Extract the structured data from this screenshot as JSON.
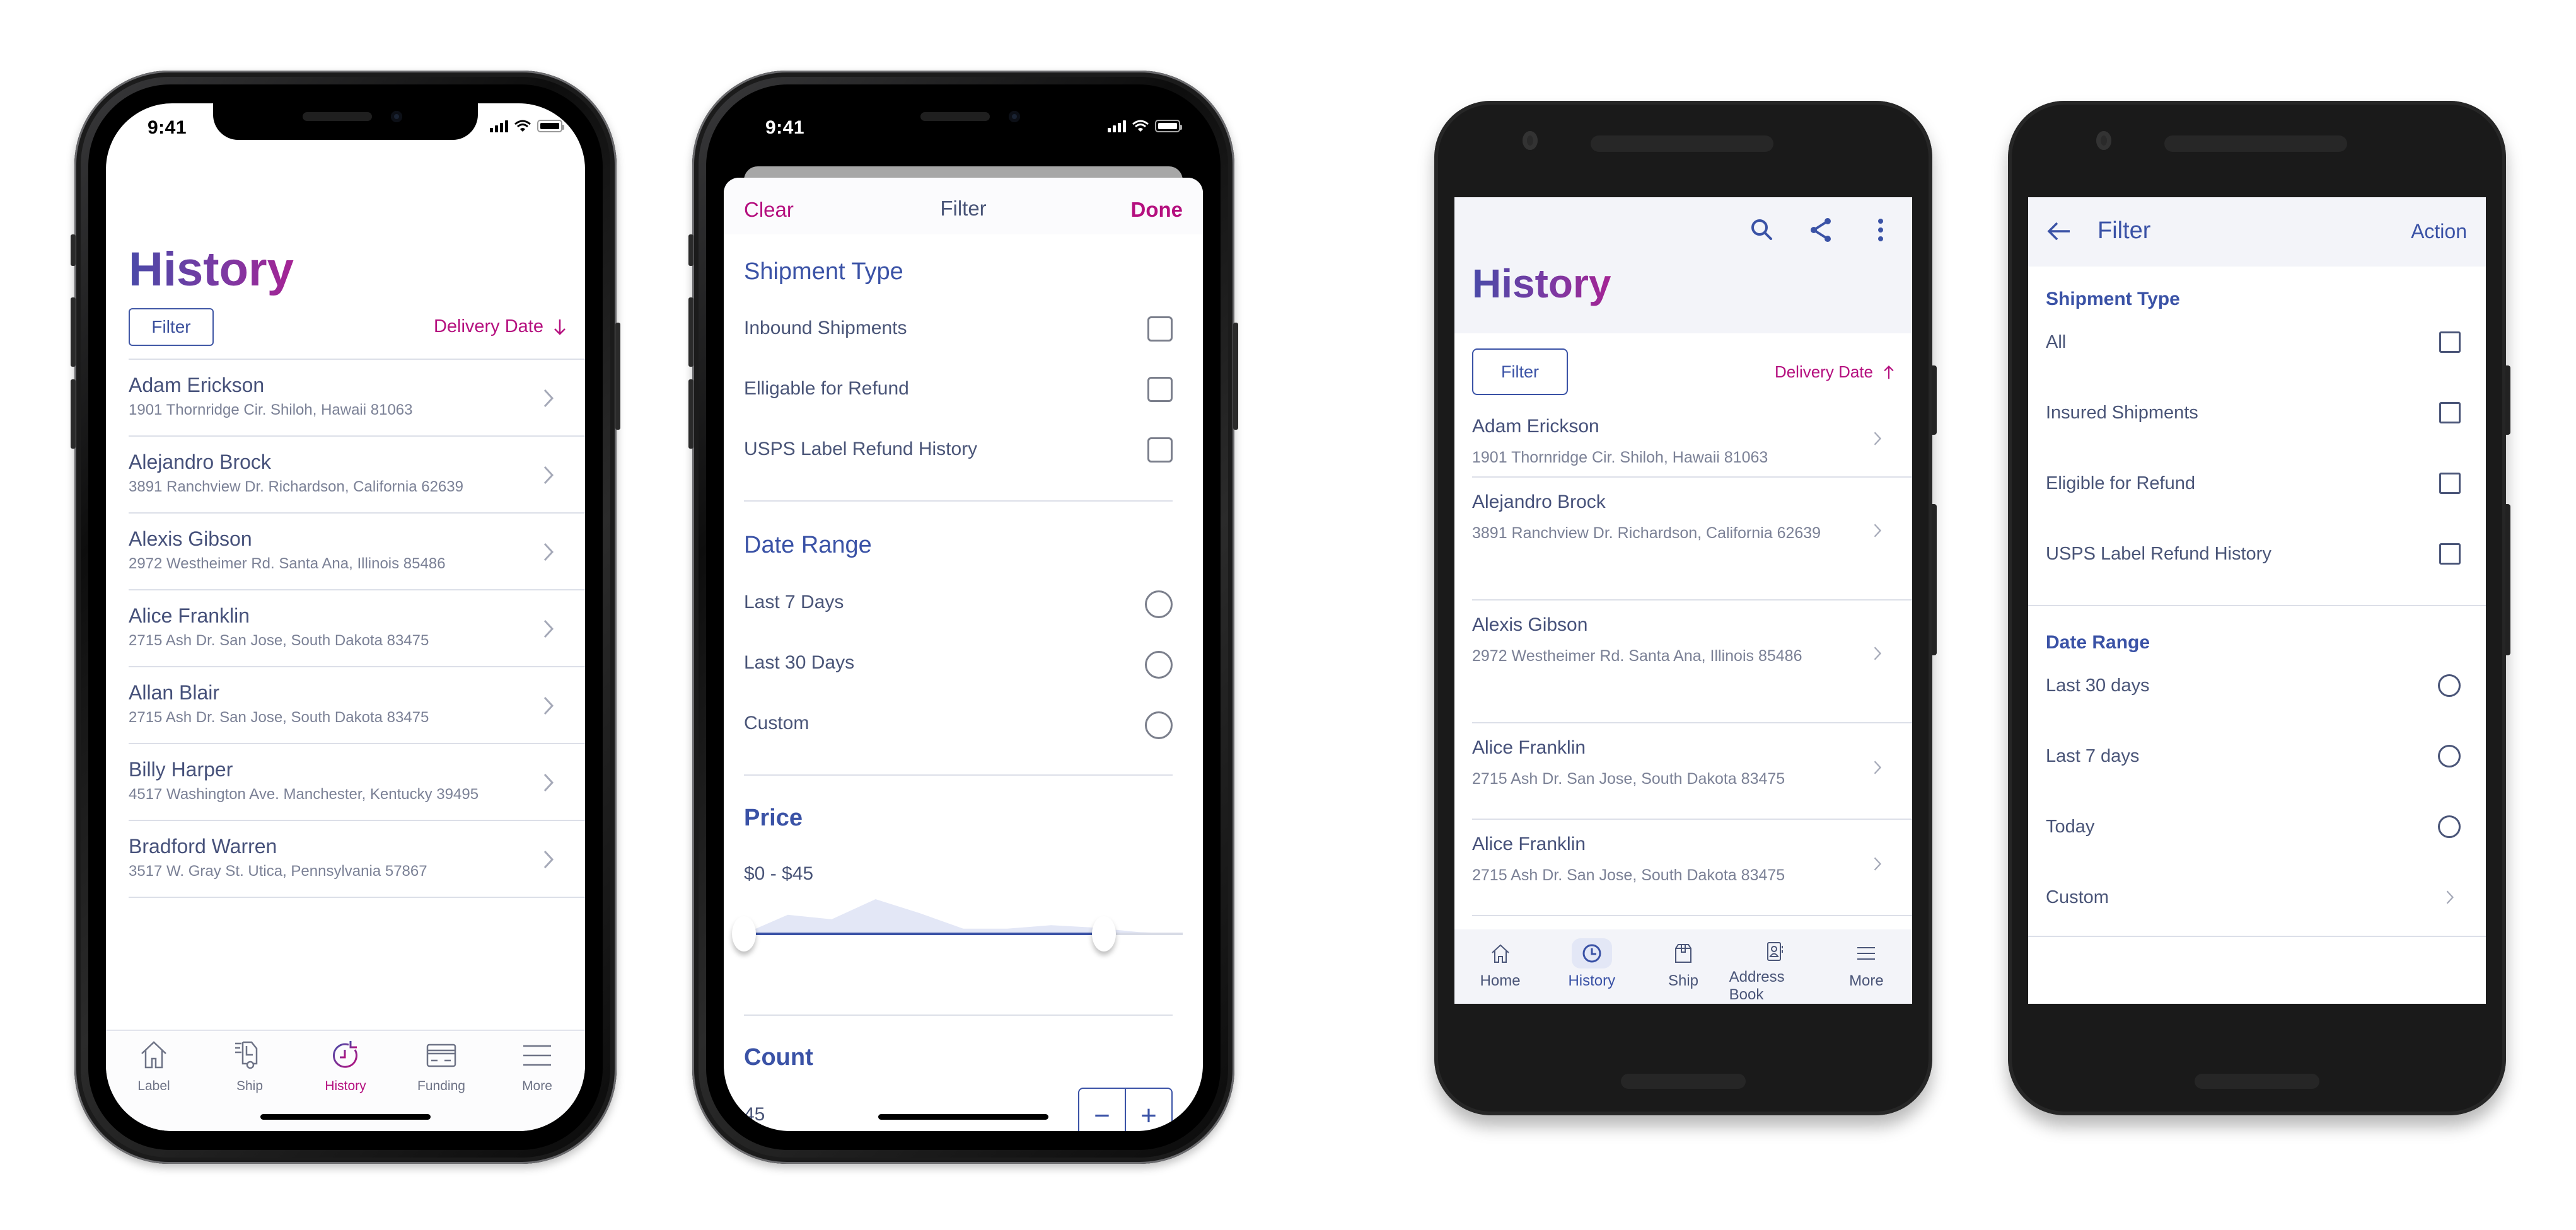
{
  "colors": {
    "brand_blue": "#3a52a6",
    "accent_magenta": "#b5107f",
    "text_primary": "#46517a",
    "text_secondary": "#7b8196",
    "title_gradient": [
      "#4a4aa8",
      "#a52394"
    ]
  },
  "ios_history": {
    "status_time": "9:41",
    "title": "History",
    "filter_label": "Filter",
    "sort_label": "Delivery Date",
    "sort_direction": "descending",
    "rows": [
      {
        "name": "Adam Erickson",
        "address": "1901 Thornridge Cir. Shiloh, Hawaii 81063"
      },
      {
        "name": "Alejandro Brock",
        "address": "3891 Ranchview Dr. Richardson, California 62639"
      },
      {
        "name": "Alexis Gibson",
        "address": "2972 Westheimer Rd. Santa Ana, Illinois 85486"
      },
      {
        "name": "Alice Franklin",
        "address": "2715 Ash Dr. San Jose, South Dakota 83475"
      },
      {
        "name": "Allan Blair",
        "address": "2715 Ash Dr. San Jose, South Dakota 83475"
      },
      {
        "name": "Billy Harper",
        "address": "4517 Washington Ave. Manchester, Kentucky 39495"
      },
      {
        "name": "Bradford Warren",
        "address": "3517 W. Gray St. Utica, Pennsylvania 57867"
      }
    ],
    "tabs": [
      {
        "label": "Label",
        "icon": "home-icon"
      },
      {
        "label": "Ship",
        "icon": "truck-icon"
      },
      {
        "label": "History",
        "icon": "history-icon",
        "active": true
      },
      {
        "label": "Funding",
        "icon": "credit-card-icon"
      },
      {
        "label": "More",
        "icon": "menu-icon"
      }
    ]
  },
  "ios_filter": {
    "status_time": "9:41",
    "clear_label": "Clear",
    "title": "Filter",
    "done_label": "Done",
    "shipment_type": {
      "heading": "Shipment Type",
      "options": [
        {
          "label": "Inbound Shipments",
          "checked": false
        },
        {
          "label": "Elligable for Refund",
          "checked": false
        },
        {
          "label": "USPS Label Refund History",
          "checked": false
        }
      ]
    },
    "date_range": {
      "heading": "Date Range",
      "options": [
        {
          "label": "Last 7 Days",
          "selected": false
        },
        {
          "label": "Last 30 Days",
          "selected": false
        },
        {
          "label": "Custom",
          "selected": false
        }
      ]
    },
    "price": {
      "heading": "Price",
      "range_label": "$0 - $45",
      "range_min_fraction": 0.0,
      "range_max_fraction": 0.82,
      "histogram": [
        0.0,
        0.55,
        0.42,
        1.0,
        0.6,
        0.15,
        0.15,
        0.25,
        0.18,
        0.05,
        0.0
      ]
    },
    "count": {
      "heading": "Count",
      "value": "45",
      "decrement_label": "−",
      "increment_label": "+"
    }
  },
  "android_history": {
    "title": "History",
    "actions": [
      {
        "icon": "search-icon"
      },
      {
        "icon": "share-icon"
      },
      {
        "icon": "more-vert-icon"
      }
    ],
    "filter_label": "Filter",
    "sort_label": "Delivery Date",
    "sort_direction": "ascending",
    "rows": [
      {
        "name": "Adam Erickson",
        "address": "1901 Thornridge Cir. Shiloh, Hawaii 81063"
      },
      {
        "name": "Alejandro Brock",
        "address": "3891 Ranchview Dr. Richardson, California 62639"
      },
      {
        "name": "Alexis Gibson",
        "address": "2972 Westheimer Rd. Santa Ana, Illinois 85486"
      },
      {
        "name": "Alice Franklin",
        "address": "2715 Ash Dr. San Jose, South Dakota 83475"
      },
      {
        "name": "Alice Franklin",
        "address": "2715 Ash Dr. San Jose, South Dakota 83475"
      }
    ],
    "nav": [
      {
        "label": "Home",
        "icon": "home-icon"
      },
      {
        "label": "History",
        "icon": "clock-icon",
        "active": true
      },
      {
        "label": "Ship",
        "icon": "package-icon"
      },
      {
        "label": "Address Book",
        "icon": "address-book-icon"
      },
      {
        "label": "More",
        "icon": "menu-icon"
      }
    ]
  },
  "android_filter": {
    "title": "Filter",
    "action_label": "Action",
    "shipment_type": {
      "heading": "Shipment Type",
      "options": [
        {
          "label": "All",
          "checked": false
        },
        {
          "label": "Insured Shipments",
          "checked": false
        },
        {
          "label": "Eligible for Refund",
          "checked": false
        },
        {
          "label": "USPS Label Refund History",
          "checked": false
        }
      ]
    },
    "date_range": {
      "heading": "Date Range",
      "options": [
        {
          "label": "Last 30 days",
          "type": "radio",
          "selected": false
        },
        {
          "label": "Last 7 days",
          "type": "radio",
          "selected": false
        },
        {
          "label": "Today",
          "type": "radio",
          "selected": false
        },
        {
          "label": "Custom",
          "type": "link"
        }
      ]
    }
  }
}
